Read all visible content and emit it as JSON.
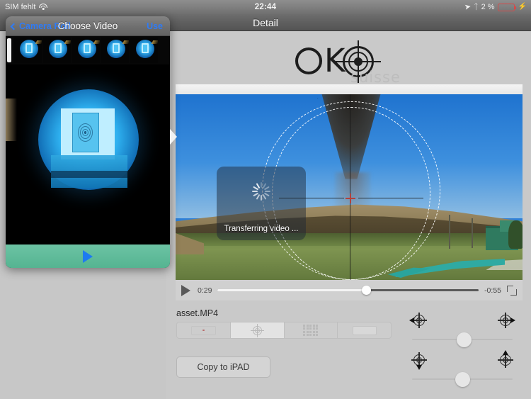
{
  "status_bar": {
    "carrier": "SIM fehlt",
    "wifi_icon": "wifi-icon",
    "time": "22:44",
    "location_icon": "location-arrow-icon",
    "bluetooth_icon": "bluetooth-icon",
    "battery_percent": "2 %",
    "battery_icon": "battery-low-icon",
    "charging_icon": "charging-bolt-icon",
    "battery_color": "#d34b4b"
  },
  "navbar": {
    "title": "Detail"
  },
  "logo": {
    "word": "OKO",
    "k_letter": "K",
    "subtitle": "suisse"
  },
  "player": {
    "elapsed": "0:29",
    "remaining": "-0:55",
    "play_icon": "play-icon",
    "expand_icon": "fullscreen-expand-icon",
    "scrub_position_percent": 57,
    "overlay_label": "Transferring video ...",
    "reticle_ticks": ". . . . . ."
  },
  "detail": {
    "asset_name": "asset.MP4",
    "copy_button": "Copy to iPAD",
    "segmented": {
      "selected_index": 1,
      "options": [
        {
          "name": "dot-reticle-option",
          "icon": "red-dot-icon"
        },
        {
          "name": "crosshair-reticle-option",
          "icon": "crosshair-icon"
        },
        {
          "name": "grid-reticle-option",
          "icon": "grid-icon"
        },
        {
          "name": "blank-reticle-option",
          "icon": "blank-rect-icon"
        }
      ]
    },
    "pad": {
      "left_icon": "crosshair-left-icon",
      "right_icon": "crosshair-right-icon",
      "down_icon": "crosshair-down-icon",
      "up_icon": "crosshair-up-icon",
      "slider_horizontal_percent": 52,
      "slider_vertical_percent": 50
    }
  },
  "popover": {
    "back_label": "Camera Roll",
    "title": "Choose Video",
    "use_label": "Use",
    "back_icon": "chevron-left-icon",
    "play_icon": "play-icon",
    "thumbnails": [
      {
        "name": "filmstrip-thumb-1"
      },
      {
        "name": "filmstrip-thumb-2"
      },
      {
        "name": "filmstrip-thumb-3"
      },
      {
        "name": "filmstrip-thumb-4"
      },
      {
        "name": "filmstrip-thumb-5"
      }
    ],
    "accent_color": "#2f7bf5",
    "footer_color": "#5bb998"
  }
}
